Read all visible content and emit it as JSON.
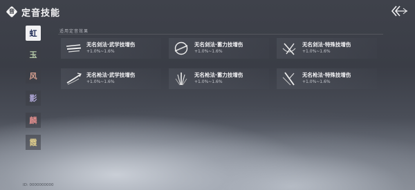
{
  "header": {
    "logo_glyph": "音",
    "title": "定音技能"
  },
  "sidebar": {
    "items": [
      {
        "label": "虹",
        "active": true
      },
      {
        "label": "玉",
        "active": false
      },
      {
        "label": "风",
        "active": false
      },
      {
        "label": "影",
        "active": false
      },
      {
        "label": "麟",
        "active": false
      },
      {
        "label": "霞",
        "active": false
      }
    ]
  },
  "section": {
    "label": "适用定音效果"
  },
  "skills": [
    {
      "name": "无名剑法·武学技增伤",
      "value": "+1.0%~1.6%",
      "icon": "sword-slash-icon"
    },
    {
      "name": "无名剑法·蓄力技增伤",
      "value": "+1.0%~1.6%",
      "icon": "sword-charge-icon"
    },
    {
      "name": "无名剑法·特殊技增伤",
      "value": "+1.0%~1.6%",
      "icon": "sword-special-icon"
    },
    {
      "name": "无名枪法·武学技增伤",
      "value": "+1.0%~1.6%",
      "icon": "spear-slash-icon"
    },
    {
      "name": "无名枪法·蓄力技增伤",
      "value": "+1.0%~1.6%",
      "icon": "spear-charge-icon"
    },
    {
      "name": "无名枪法·特殊技增伤",
      "value": "+1.0%~1.6%",
      "icon": "spear-special-icon"
    }
  ],
  "footer": {
    "uid": "ID: 0000000000"
  }
}
